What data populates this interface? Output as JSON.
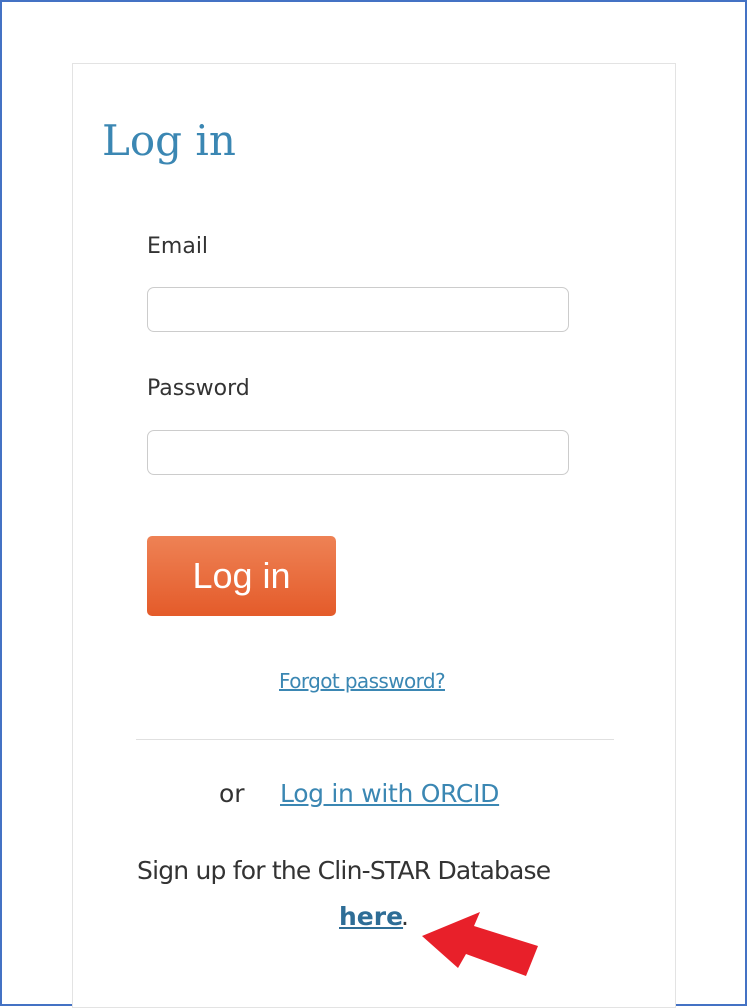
{
  "login_form": {
    "title": "Log in",
    "email_label": "Email",
    "email_value": "",
    "password_label": "Password",
    "password_value": "",
    "submit_label": "Log in",
    "forgot_password_label": "Forgot password?",
    "or_text": "or",
    "orcid_label": "Log in with ORCID",
    "signup_text": "Sign up for the Clin-STAR Database",
    "signup_link_label": "here",
    "signup_period": "."
  },
  "annotation": {
    "arrow_icon": "red-arrow-icon",
    "arrow_color": "#e8202a"
  },
  "colors": {
    "accent": "#3b87b3",
    "button": "#e45b2a",
    "frame_border": "#4472c4"
  }
}
